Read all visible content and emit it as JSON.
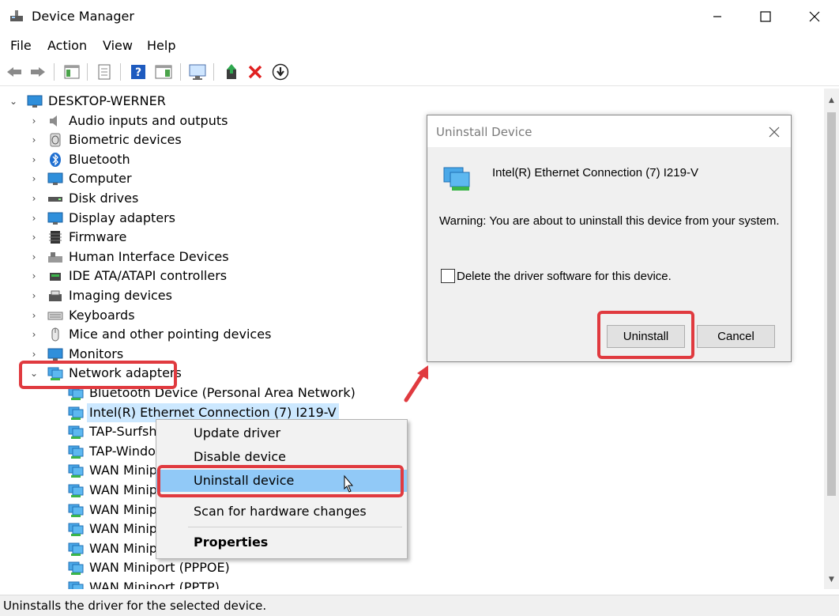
{
  "window": {
    "title": "Device Manager",
    "controls": [
      "minimize",
      "maximize",
      "close"
    ]
  },
  "menu": [
    "File",
    "Action",
    "View",
    "Help"
  ],
  "toolbar": {
    "buttons": [
      "back-icon",
      "forward-icon",
      "show-hide-console-tree-icon",
      "properties-icon",
      "help-icon",
      "action-pane-icon",
      "monitor-icon",
      "update-driver-icon",
      "uninstall-icon",
      "download-icon"
    ]
  },
  "tree": {
    "root": "DESKTOP-WERNER",
    "categories": [
      "Audio inputs and outputs",
      "Biometric devices",
      "Bluetooth",
      "Computer",
      "Disk drives",
      "Display adapters",
      "Firmware",
      "Human Interface Devices",
      "IDE ATA/ATAPI controllers",
      "Imaging devices",
      "Keyboards",
      "Mice and other pointing devices",
      "Monitors",
      "Network adapters"
    ],
    "network_children": [
      "Bluetooth Device (Personal Area Network)",
      "Intel(R) Ethernet Connection (7) I219-V",
      "TAP-Surfsha",
      "TAP-Windo",
      "WAN Minip",
      "WAN Minip",
      "WAN Minip",
      "WAN Minip",
      "WAN Minip",
      "WAN Miniport (PPPOE)",
      "WAN Miniport (PPTP)"
    ]
  },
  "context_menu": {
    "items": [
      "Update driver",
      "Disable device",
      "Uninstall device",
      "Scan for hardware changes",
      "Properties"
    ],
    "highlighted": "Uninstall device"
  },
  "dialog": {
    "title": "Uninstall Device",
    "device_name": "Intel(R) Ethernet Connection (7) I219-V",
    "warning": "Warning: You are about to uninstall this device from your system.",
    "checkbox_label": "Delete the driver software for this device.",
    "checkbox_checked": false,
    "uninstall_button": "Uninstall",
    "cancel_button": "Cancel"
  },
  "status": {
    "text": "Uninstalls the driver for the selected device."
  },
  "colors": {
    "highlight_red": "#e03a3f",
    "selection": "#cce8ff",
    "menu_hover": "#91c9f7"
  }
}
